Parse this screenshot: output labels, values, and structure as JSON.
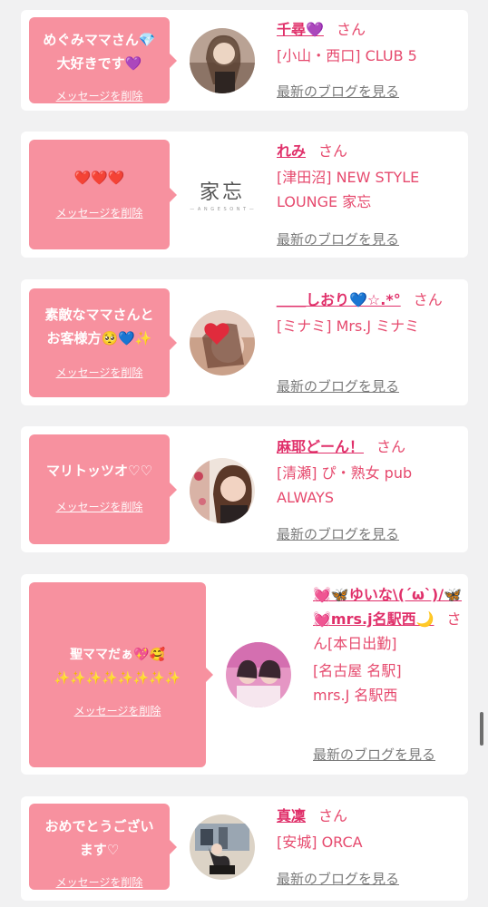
{
  "delete_label": "メッセージを削除",
  "san": "さん",
  "blog_link": "最新のブログを見る",
  "cards": [
    {
      "message": "めぐみママさん💎\n大好きです💜",
      "name": "千尋💜",
      "shop": "[小山・西口] CLUB 5",
      "avatar_icon": "profile-photo"
    },
    {
      "message": "❤️❤️❤️",
      "name": "れみ",
      "shop": "[津田沼] NEW STYLE LOUNGE 家忘",
      "avatar_icon": "shop-logo",
      "logo_text": "家忘",
      "logo_sub": "— A N G E S O N T —"
    },
    {
      "message": "素敵なママさんと\nお客様方🥺💙✨",
      "name": "＿＿しおり💙☆.*°",
      "shop": "[ミナミ] Mrs.J ミナミ",
      "avatar_icon": "profile-photo"
    },
    {
      "message": "マリトッツオ♡♡",
      "name": "麻耶どーん！",
      "shop": "[清瀬] ぴ・熟女 pub ALWAYS",
      "avatar_icon": "profile-photo"
    },
    {
      "message": "聖ママだぁ💖🥰\n✨✨✨✨✨✨✨✨",
      "name": "💓🦋ゆいな\\(´ω`)/🦋💓mrs.j名駅西🌙",
      "name_suffix": "さん[本日出勤]",
      "shop": "[名古屋 名駅] mrs.J 名駅西",
      "avatar_icon": "profile-photo"
    },
    {
      "message": "おめでとうござい\nます♡",
      "name": "真凜",
      "shop": "[安城] ORCA",
      "avatar_icon": "profile-photo"
    }
  ]
}
